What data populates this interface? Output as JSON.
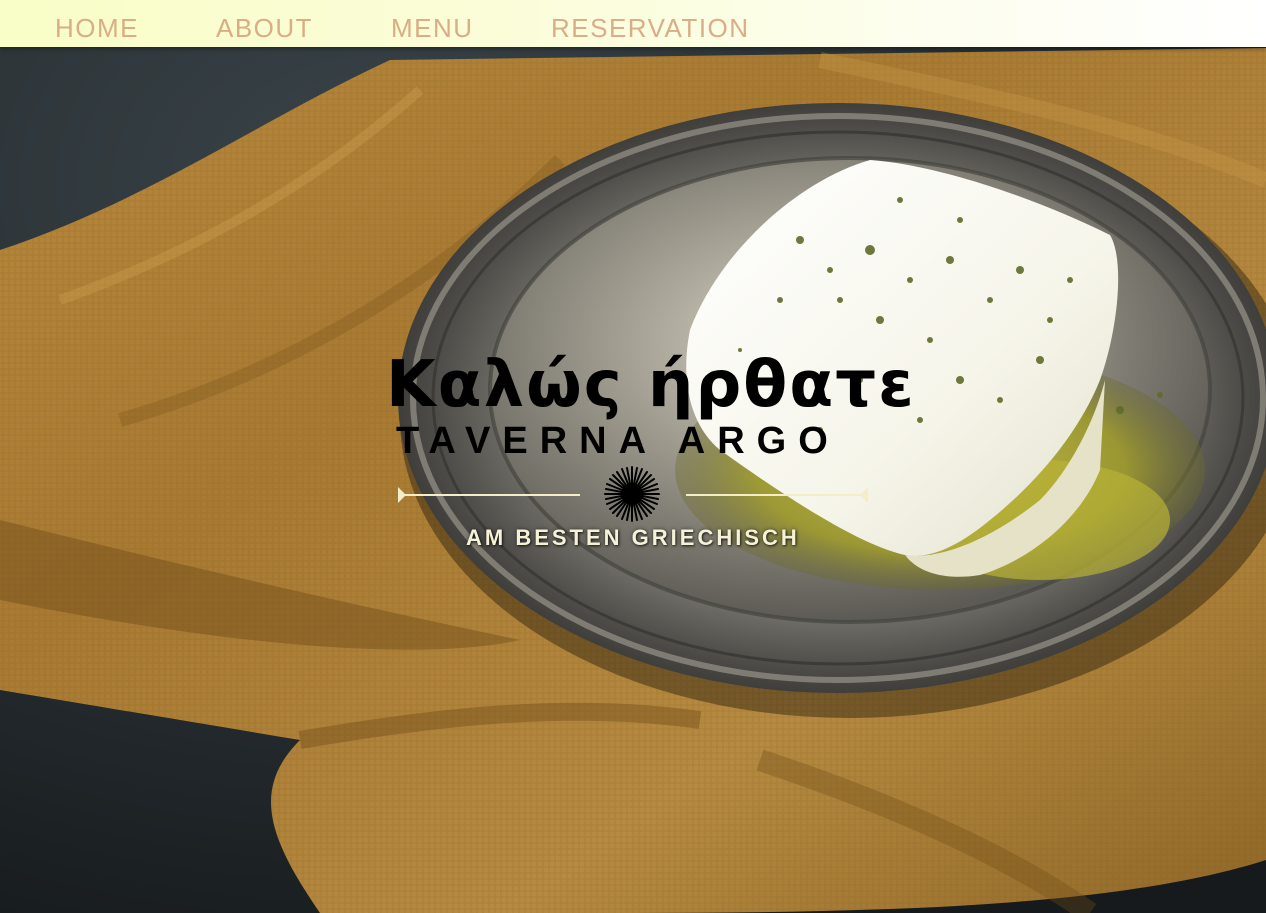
{
  "nav": {
    "items": [
      {
        "label": "HOME"
      },
      {
        "label": "ABOUT"
      },
      {
        "label": "MENU"
      },
      {
        "label": "RESERVATION"
      }
    ]
  },
  "hero": {
    "welcome": "Καλώς ήρθατε",
    "brand": "TAVERNA ARGO",
    "tagline": "AM BESTEN GRIECHISCH",
    "divider_icon": "sunburst-icon"
  },
  "colors": {
    "nav_background": "#fbfdd9",
    "nav_text": "#d9ad86",
    "title_text": "#000000",
    "tagline_text": "#f6f2d8",
    "divider_line": "#f4edc8"
  }
}
